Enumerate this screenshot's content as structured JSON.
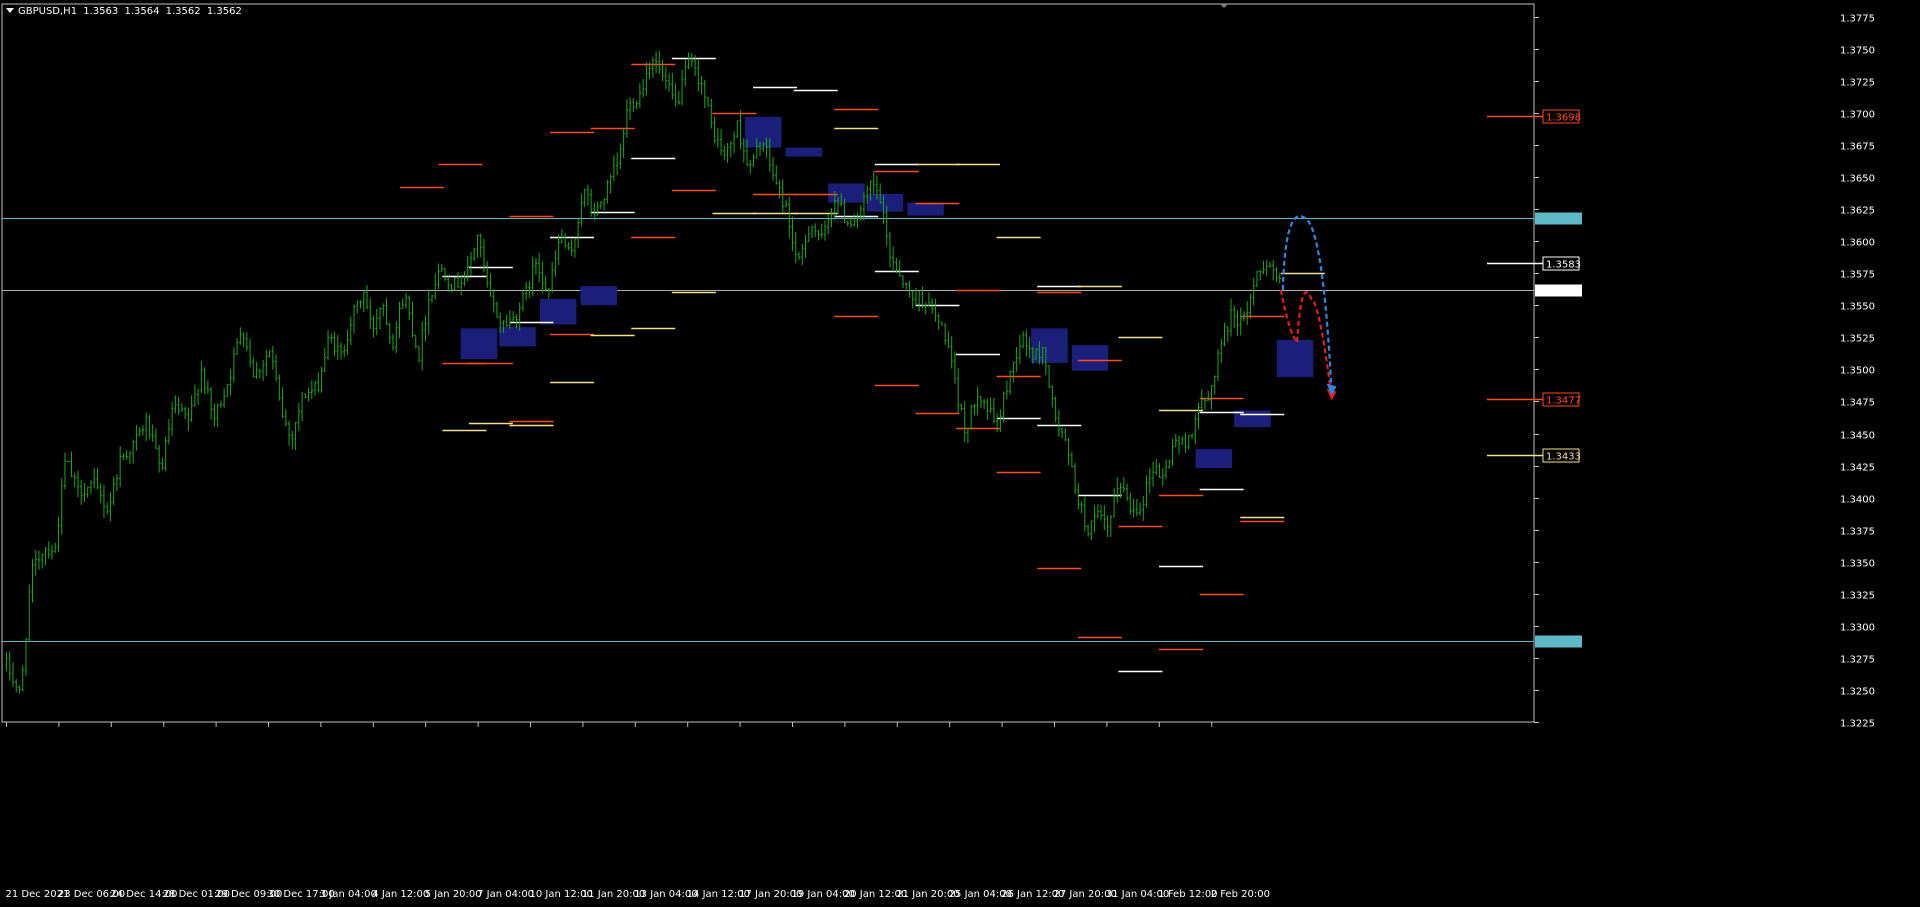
{
  "header": {
    "symbol": "GBPUSD,H1",
    "ohlc": [
      "1.3563",
      "1.3564",
      "1.3562",
      "1.3562"
    ]
  },
  "colors": {
    "background": "#000000",
    "grid_frame": "#c0c0c0",
    "candle": "#1fa51f",
    "axis_text": "#ffffff",
    "hline": "#5fb8c8",
    "bid_line": "#b0b0b0",
    "zone": "#1c1f7a",
    "level_red": "#ff4a1a",
    "level_white": "#ffffff",
    "level_yellow": "#f2e08c",
    "arrow_red": "#e31c1c",
    "arrow_blue": "#2f86e0"
  },
  "chart_data": {
    "type": "candlestick",
    "symbol": "GBPUSD",
    "timeframe": "H1",
    "ylim": [
      1.3225,
      1.3785
    ],
    "y_ticks": [
      "1.3775",
      "1.3750",
      "1.3725",
      "1.3700",
      "1.3675",
      "1.3650",
      "1.3625",
      "1.3600",
      "1.3575",
      "1.3550",
      "1.3525",
      "1.3500",
      "1.3475",
      "1.3450",
      "1.3425",
      "1.3400",
      "1.3375",
      "1.3350",
      "1.3325",
      "1.3300",
      "1.3275",
      "1.3250",
      "1.3225"
    ],
    "x_ticks": [
      "21 Dec 2021",
      "23 Dec 06:00",
      "24 Dec 14:00",
      "28 Dec 01:00",
      "29 Dec 09:00",
      "30 Dec 17:00",
      "3 Jan 04:00",
      "4 Jan 12:00",
      "5 Jan 20:00",
      "7 Jan 04:00",
      "10 Jan 12:00",
      "11 Jan 20:00",
      "13 Jan 04:00",
      "14 Jan 12:00",
      "17 Jan 20:00",
      "19 Jan 04:00",
      "20 Jan 12:00",
      "21 Jan 20:00",
      "25 Jan 04:00",
      "26 Jan 12:00",
      "27 Jan 20:00",
      "31 Jan 04:00",
      "1 Feb 12:00",
      "2 Feb 20:00"
    ],
    "price_path": [
      [
        0,
        1.327
      ],
      [
        0.7,
        1.3245
      ],
      [
        1.2,
        1.334
      ],
      [
        1.8,
        1.336
      ],
      [
        2.4,
        1.336
      ],
      [
        2.9,
        1.343
      ],
      [
        3.5,
        1.3405
      ],
      [
        4.3,
        1.341
      ],
      [
        5.0,
        1.339
      ],
      [
        5.6,
        1.343
      ],
      [
        6.2,
        1.344
      ],
      [
        6.9,
        1.346
      ],
      [
        7.6,
        1.342
      ],
      [
        8.2,
        1.347
      ],
      [
        9.0,
        1.346
      ],
      [
        9.6,
        1.35
      ],
      [
        10.2,
        1.346
      ],
      [
        11.0,
        1.3495
      ],
      [
        11.6,
        1.3535
      ],
      [
        12.2,
        1.3495
      ],
      [
        13.0,
        1.3515
      ],
      [
        13.5,
        1.347
      ],
      [
        14.0,
        1.3445
      ],
      [
        14.6,
        1.348
      ],
      [
        15.3,
        1.3485
      ],
      [
        15.9,
        1.3525
      ],
      [
        16.5,
        1.351
      ],
      [
        17.0,
        1.354
      ],
      [
        17.6,
        1.356
      ],
      [
        18.0,
        1.353
      ],
      [
        18.5,
        1.3555
      ],
      [
        19.0,
        1.352
      ],
      [
        19.6,
        1.356
      ],
      [
        20.3,
        1.351
      ],
      [
        20.8,
        1.3555
      ],
      [
        21.4,
        1.358
      ],
      [
        22.0,
        1.3565
      ],
      [
        22.7,
        1.3575
      ],
      [
        23.2,
        1.3605
      ],
      [
        23.8,
        1.3555
      ],
      [
        24.4,
        1.3535
      ],
      [
        25.0,
        1.354
      ],
      [
        25.6,
        1.356
      ],
      [
        26.1,
        1.3585
      ],
      [
        26.7,
        1.356
      ],
      [
        27.3,
        1.3605
      ],
      [
        27.8,
        1.3585
      ],
      [
        28.4,
        1.364
      ],
      [
        29.0,
        1.362
      ],
      [
        29.7,
        1.3645
      ],
      [
        30.2,
        1.3665
      ],
      [
        30.6,
        1.3705
      ],
      [
        31.2,
        1.3715
      ],
      [
        31.8,
        1.3745
      ],
      [
        32.4,
        1.3725
      ],
      [
        33.0,
        1.3705
      ],
      [
        33.6,
        1.374
      ],
      [
        34.2,
        1.3725
      ],
      [
        34.8,
        1.3685
      ],
      [
        35.4,
        1.3665
      ],
      [
        36.0,
        1.369
      ],
      [
        36.6,
        1.3655
      ],
      [
        37.2,
        1.368
      ],
      [
        37.8,
        1.365
      ],
      [
        38.4,
        1.3625
      ],
      [
        39.0,
        1.358
      ],
      [
        39.6,
        1.3615
      ],
      [
        40.2,
        1.36
      ],
      [
        40.8,
        1.3635
      ],
      [
        41.4,
        1.3615
      ],
      [
        42.0,
        1.362
      ],
      [
        42.6,
        1.3645
      ],
      [
        43.0,
        1.3635
      ],
      [
        43.5,
        1.359
      ],
      [
        44.0,
        1.3575
      ],
      [
        44.6,
        1.3555
      ],
      [
        45.2,
        1.3555
      ],
      [
        45.8,
        1.354
      ],
      [
        46.3,
        1.3525
      ],
      [
        46.8,
        1.348
      ],
      [
        47.3,
        1.345
      ],
      [
        47.8,
        1.3485
      ],
      [
        48.3,
        1.347
      ],
      [
        48.8,
        1.3455
      ],
      [
        49.4,
        1.3495
      ],
      [
        50.0,
        1.3525
      ],
      [
        50.6,
        1.351
      ],
      [
        51.1,
        1.3515
      ],
      [
        51.6,
        1.3465
      ],
      [
        52.2,
        1.344
      ],
      [
        52.7,
        1.3405
      ],
      [
        53.2,
        1.3375
      ],
      [
        53.8,
        1.3385
      ],
      [
        54.3,
        1.3375
      ],
      [
        54.8,
        1.3415
      ],
      [
        55.4,
        1.339
      ],
      [
        55.9,
        1.3395
      ],
      [
        56.5,
        1.3425
      ],
      [
        57.0,
        1.3415
      ],
      [
        57.5,
        1.3445
      ],
      [
        58.1,
        1.344
      ],
      [
        58.7,
        1.347
      ],
      [
        59.2,
        1.3475
      ],
      [
        59.8,
        1.352
      ],
      [
        60.4,
        1.3545
      ],
      [
        60.9,
        1.3535
      ],
      [
        61.5,
        1.357
      ],
      [
        62.0,
        1.3585
      ],
      [
        62.5,
        1.3575
      ],
      [
        63.0,
        1.3562
      ]
    ],
    "horizontal_lines": [
      {
        "price": 1.3618,
        "label": "1.3618",
        "kind": "hline"
      },
      {
        "price": 1.3288,
        "label": "1.3288",
        "kind": "hline"
      },
      {
        "price": 1.3562,
        "label": "1.3562",
        "kind": "bid"
      }
    ],
    "level_labels": [
      {
        "price": 1.3698,
        "label": "1.3698",
        "color": "red"
      },
      {
        "price": 1.3583,
        "label": "1.3583",
        "color": "white"
      },
      {
        "price": 1.3477,
        "label": "1.3477",
        "color": "red"
      },
      {
        "price": 1.3433,
        "label": "1.3433",
        "color": "yellow"
      }
    ],
    "level_segments": [
      {
        "x": 19.4,
        "price": 1.3642,
        "color": "red"
      },
      {
        "x": 21.5,
        "price": 1.3573,
        "color": "white"
      },
      {
        "x": 21.5,
        "price": 1.3453,
        "color": "yellow"
      },
      {
        "x": 21.5,
        "price": 1.3505,
        "color": "red"
      },
      {
        "x": 21.3,
        "price": 1.366,
        "color": "red"
      },
      {
        "x": 22.8,
        "price": 1.358,
        "color": "white"
      },
      {
        "x": 22.8,
        "price": 1.3505,
        "color": "red"
      },
      {
        "x": 22.8,
        "price": 1.3458,
        "color": "yellow"
      },
      {
        "x": 24.8,
        "price": 1.362,
        "color": "red"
      },
      {
        "x": 24.8,
        "price": 1.3537,
        "color": "white"
      },
      {
        "x": 24.8,
        "price": 1.346,
        "color": "red"
      },
      {
        "x": 24.8,
        "price": 1.3457,
        "color": "yellow"
      },
      {
        "x": 26.8,
        "price": 1.3685,
        "color": "red"
      },
      {
        "x": 26.8,
        "price": 1.3603,
        "color": "white"
      },
      {
        "x": 26.8,
        "price": 1.3528,
        "color": "red"
      },
      {
        "x": 26.8,
        "price": 1.349,
        "color": "yellow"
      },
      {
        "x": 28.8,
        "price": 1.3688,
        "color": "red"
      },
      {
        "x": 28.8,
        "price": 1.3623,
        "color": "white"
      },
      {
        "x": 28.8,
        "price": 1.3527,
        "color": "yellow"
      },
      {
        "x": 30.8,
        "price": 1.3738,
        "color": "red"
      },
      {
        "x": 30.8,
        "price": 1.3665,
        "color": "white"
      },
      {
        "x": 30.8,
        "price": 1.3603,
        "color": "red"
      },
      {
        "x": 30.8,
        "price": 1.3532,
        "color": "yellow"
      },
      {
        "x": 32.8,
        "price": 1.3743,
        "color": "white"
      },
      {
        "x": 32.8,
        "price": 1.364,
        "color": "red"
      },
      {
        "x": 32.8,
        "price": 1.356,
        "color": "yellow"
      },
      {
        "x": 34.8,
        "price": 1.37,
        "color": "red"
      },
      {
        "x": 34.8,
        "price": 1.3622,
        "color": "yellow"
      },
      {
        "x": 36.8,
        "price": 1.372,
        "color": "white"
      },
      {
        "x": 36.8,
        "price": 1.3637,
        "color": "red"
      },
      {
        "x": 36.8,
        "price": 1.3622,
        "color": "yellow"
      },
      {
        "x": 38.8,
        "price": 1.3718,
        "color": "white"
      },
      {
        "x": 38.8,
        "price": 1.3637,
        "color": "red"
      },
      {
        "x": 38.8,
        "price": 1.3622,
        "color": "yellow"
      },
      {
        "x": 40.8,
        "price": 1.3703,
        "color": "red"
      },
      {
        "x": 40.8,
        "price": 1.3688,
        "color": "yellow"
      },
      {
        "x": 40.8,
        "price": 1.362,
        "color": "white"
      },
      {
        "x": 40.8,
        "price": 1.3542,
        "color": "red"
      },
      {
        "x": 42.8,
        "price": 1.366,
        "color": "white"
      },
      {
        "x": 42.8,
        "price": 1.3655,
        "color": "red"
      },
      {
        "x": 42.8,
        "price": 1.3577,
        "color": "white"
      },
      {
        "x": 42.8,
        "price": 1.3488,
        "color": "red"
      },
      {
        "x": 44.8,
        "price": 1.366,
        "color": "yellow"
      },
      {
        "x": 44.8,
        "price": 1.363,
        "color": "red"
      },
      {
        "x": 44.8,
        "price": 1.355,
        "color": "white"
      },
      {
        "x": 44.8,
        "price": 1.3466,
        "color": "red"
      },
      {
        "x": 46.8,
        "price": 1.366,
        "color": "yellow"
      },
      {
        "x": 46.8,
        "price": 1.3562,
        "color": "red"
      },
      {
        "x": 46.8,
        "price": 1.3512,
        "color": "white"
      },
      {
        "x": 46.8,
        "price": 1.3454,
        "color": "red"
      },
      {
        "x": 48.8,
        "price": 1.3603,
        "color": "yellow"
      },
      {
        "x": 48.8,
        "price": 1.3495,
        "color": "red"
      },
      {
        "x": 48.8,
        "price": 1.3462,
        "color": "white"
      },
      {
        "x": 48.8,
        "price": 1.342,
        "color": "red"
      },
      {
        "x": 50.8,
        "price": 1.3565,
        "color": "white"
      },
      {
        "x": 50.8,
        "price": 1.356,
        "color": "red"
      },
      {
        "x": 50.8,
        "price": 1.3457,
        "color": "white"
      },
      {
        "x": 50.8,
        "price": 1.3345,
        "color": "red"
      },
      {
        "x": 52.8,
        "price": 1.3565,
        "color": "yellow"
      },
      {
        "x": 52.8,
        "price": 1.3507,
        "color": "red"
      },
      {
        "x": 52.8,
        "price": 1.3402,
        "color": "white"
      },
      {
        "x": 52.8,
        "price": 1.3291,
        "color": "red"
      },
      {
        "x": 54.8,
        "price": 1.3525,
        "color": "yellow"
      },
      {
        "x": 54.8,
        "price": 1.3378,
        "color": "red"
      },
      {
        "x": 54.8,
        "price": 1.3265,
        "color": "white"
      },
      {
        "x": 56.8,
        "price": 1.3468,
        "color": "yellow"
      },
      {
        "x": 56.8,
        "price": 1.3402,
        "color": "red"
      },
      {
        "x": 56.8,
        "price": 1.3347,
        "color": "white"
      },
      {
        "x": 56.8,
        "price": 1.3282,
        "color": "red"
      },
      {
        "x": 58.8,
        "price": 1.3478,
        "color": "red"
      },
      {
        "x": 58.8,
        "price": 1.3467,
        "color": "white"
      },
      {
        "x": 58.8,
        "price": 1.3407,
        "color": "white"
      },
      {
        "x": 58.8,
        "price": 1.3325,
        "color": "red"
      },
      {
        "x": 60.8,
        "price": 1.3542,
        "color": "red"
      },
      {
        "x": 60.8,
        "price": 1.3465,
        "color": "white"
      },
      {
        "x": 60.8,
        "price": 1.3385,
        "color": "yellow"
      },
      {
        "x": 60.8,
        "price": 1.3382,
        "color": "red"
      },
      {
        "x": 62.8,
        "price": 1.3575,
        "color": "yellow"
      }
    ],
    "zones": [
      {
        "x": 22.4,
        "w": 1.8,
        "top": 1.3532,
        "bottom": 1.3508
      },
      {
        "x": 24.3,
        "w": 1.8,
        "top": 1.3533,
        "bottom": 1.3518
      },
      {
        "x": 26.3,
        "w": 1.8,
        "top": 1.3555,
        "bottom": 1.3535
      },
      {
        "x": 28.3,
        "w": 1.8,
        "top": 1.3565,
        "bottom": 1.355
      },
      {
        "x": 36.4,
        "w": 1.8,
        "top": 1.3697,
        "bottom": 1.3673
      },
      {
        "x": 38.4,
        "w": 1.8,
        "top": 1.3673,
        "bottom": 1.3666
      },
      {
        "x": 40.5,
        "w": 1.8,
        "top": 1.3645,
        "bottom": 1.363
      },
      {
        "x": 42.4,
        "w": 1.8,
        "top": 1.3637,
        "bottom": 1.3623
      },
      {
        "x": 44.4,
        "w": 1.8,
        "top": 1.363,
        "bottom": 1.362
      },
      {
        "x": 50.5,
        "w": 1.8,
        "top": 1.3532,
        "bottom": 1.3505
      },
      {
        "x": 52.5,
        "w": 1.8,
        "top": 1.3519,
        "bottom": 1.3499
      },
      {
        "x": 58.6,
        "w": 1.8,
        "top": 1.3438,
        "bottom": 1.3423
      },
      {
        "x": 60.5,
        "w": 1.8,
        "top": 1.3468,
        "bottom": 1.3455
      },
      {
        "x": 62.6,
        "w": 1.8,
        "top": 1.3523,
        "bottom": 1.3494
      }
    ],
    "arrows": [
      {
        "color": "red",
        "path": [
          [
            62.8,
            1.3562
          ],
          [
            63.6,
            1.3521
          ],
          [
            64.3,
            1.3555
          ],
          [
            65.3,
            1.3478
          ]
        ]
      },
      {
        "color": "blue",
        "path": [
          [
            62.9,
            1.3562
          ],
          [
            64.0,
            1.3618
          ],
          [
            65.3,
            1.3482
          ]
        ]
      }
    ]
  }
}
